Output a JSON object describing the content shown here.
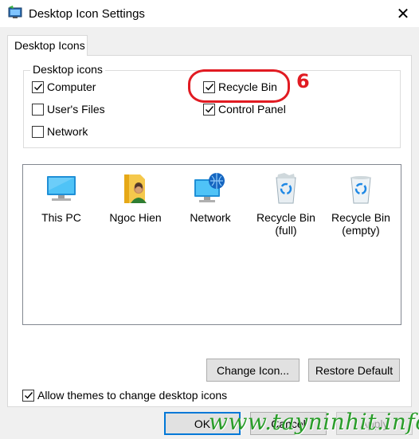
{
  "window": {
    "title": "Desktop Icon Settings",
    "close_glyph": "✕"
  },
  "tabs": [
    {
      "label": "Desktop Icons",
      "active": true
    }
  ],
  "desktop_icons_group": {
    "legend": "Desktop icons",
    "checkboxes": [
      {
        "label": "Computer",
        "checked": true
      },
      {
        "label": "User's Files",
        "checked": false
      },
      {
        "label": "Network",
        "checked": false
      },
      {
        "label": "Recycle Bin",
        "checked": true
      },
      {
        "label": "Control Panel",
        "checked": true
      }
    ]
  },
  "annotation": {
    "number": "6",
    "color": "#e11b22"
  },
  "icon_list": [
    {
      "icon": "this-pc-icon",
      "label_line1": "This PC",
      "label_line2": ""
    },
    {
      "icon": "user-folder-icon",
      "label_line1": "Ngoc Hien",
      "label_line2": ""
    },
    {
      "icon": "network-icon",
      "label_line1": "Network",
      "label_line2": ""
    },
    {
      "icon": "recycle-bin-full-icon",
      "label_line1": "Recycle Bin",
      "label_line2": "(full)"
    },
    {
      "icon": "recycle-bin-empty-icon",
      "label_line1": "Recycle Bin",
      "label_line2": "(empty)"
    }
  ],
  "buttons": {
    "change_icon": "Change Icon...",
    "restore_default": "Restore Default",
    "ok": "OK",
    "cancel": "Cancel",
    "apply": "Apply"
  },
  "allow_themes": {
    "label": "Allow themes to change desktop icons",
    "checked": true
  },
  "watermark": "www.tayninhit.info",
  "colors": {
    "accent": "#0078d7",
    "annotation": "#e11b22",
    "watermark": "#2a9d2a"
  }
}
